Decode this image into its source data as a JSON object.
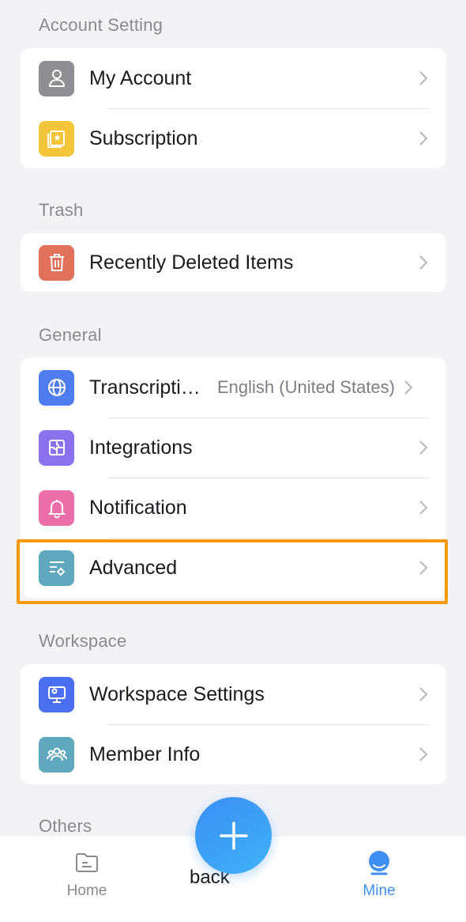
{
  "sections": {
    "account": {
      "title": "Account Setting",
      "items": [
        {
          "label": "My Account",
          "icon": "person-icon",
          "color": "#8e8e93"
        },
        {
          "label": "Subscription",
          "icon": "star-card-icon",
          "color": "#f4c53a"
        }
      ]
    },
    "trash": {
      "title": "Trash",
      "items": [
        {
          "label": "Recently Deleted Items",
          "icon": "trash-icon",
          "color": "#e2715c"
        }
      ]
    },
    "general": {
      "title": "General",
      "items": [
        {
          "label": "Transcription Language",
          "value": "English (United States)",
          "icon": "globe-icon",
          "color": "#4f7df0"
        },
        {
          "label": "Integrations",
          "icon": "puzzle-icon",
          "color": "#8a71ee"
        },
        {
          "label": "Notification",
          "icon": "bell-icon",
          "color": "#ea6fa8"
        },
        {
          "label": "Advanced",
          "icon": "settings-list-icon",
          "color": "#5fa8bd"
        }
      ]
    },
    "workspace": {
      "title": "Workspace",
      "items": [
        {
          "label": "Workspace Settings",
          "icon": "monitor-gear-icon",
          "color": "#4a6ff0"
        },
        {
          "label": "Member Info",
          "icon": "people-icon",
          "color": "#5fa8bd"
        }
      ]
    },
    "others": {
      "title": "Others"
    }
  },
  "tabbar": {
    "home_label": "Home",
    "mine_label": "Mine",
    "fab_under_text": "back"
  },
  "colors": {
    "highlight": "#f59a0c",
    "accent": "#3f8ef2"
  }
}
